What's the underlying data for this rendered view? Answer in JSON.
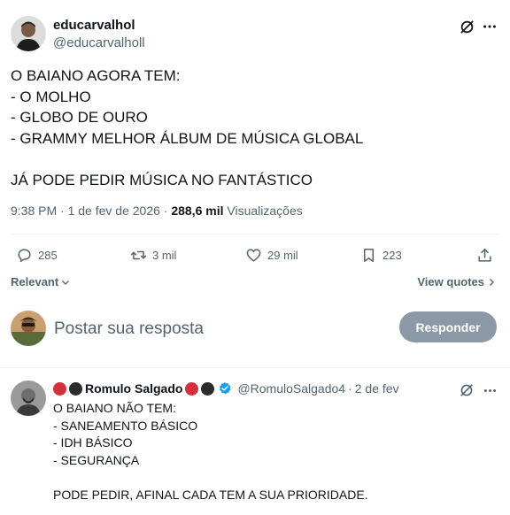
{
  "post": {
    "author_name": "educarvalhol",
    "author_handle": "@educarvalholl",
    "text": "O BAIANO AGORA TEM:\n- O MOLHO\n- GLOBO DE OURO\n- GRAMMY MELHOR ÁLBUM DE MÚSICA GLOBAL\n\nJÁ PODE PEDIR MÚSICA NO FANTÁSTICO",
    "time": "9:38 PM",
    "date": "1 de fev de 2026",
    "views_count": "288,6 mil",
    "views_label": "Visualizações",
    "separator": "·"
  },
  "actions": {
    "replies": "285",
    "reposts": "3 mil",
    "likes": "29 mil",
    "bookmarks": "223"
  },
  "controls": {
    "sort_label": "Relevant",
    "quotes_label": "View quotes"
  },
  "composer": {
    "placeholder": "Postar sua resposta",
    "button_label": "Responder"
  },
  "reply": {
    "author_name": "Romulo Salgado",
    "author_handle": "@RomuloSalgado4",
    "date": "2 de fev",
    "separator": "·",
    "text": "O BAIANO NÃO TEM:\n- SANEAMENTO BÁSICO\n- IDH BÁSICO\n- SEGURANÇA\n\nPODE PEDIR, AFINAL CADA TEM A SUA PRIORIDADE.",
    "dot_colors": [
      "#d0313a",
      "#2b2b2b"
    ]
  },
  "colors": {
    "text": "#0f1419",
    "muted": "#536471",
    "verified": "#1d9bf0",
    "button_disabled": "#8b98a5"
  },
  "icons": {
    "grok": "grok-icon",
    "more": "more-icon",
    "reply": "reply-icon",
    "repost": "repost-icon",
    "like": "heart-icon",
    "bookmark": "bookmark-icon",
    "share": "share-icon",
    "verified": "verified-badge-icon"
  }
}
